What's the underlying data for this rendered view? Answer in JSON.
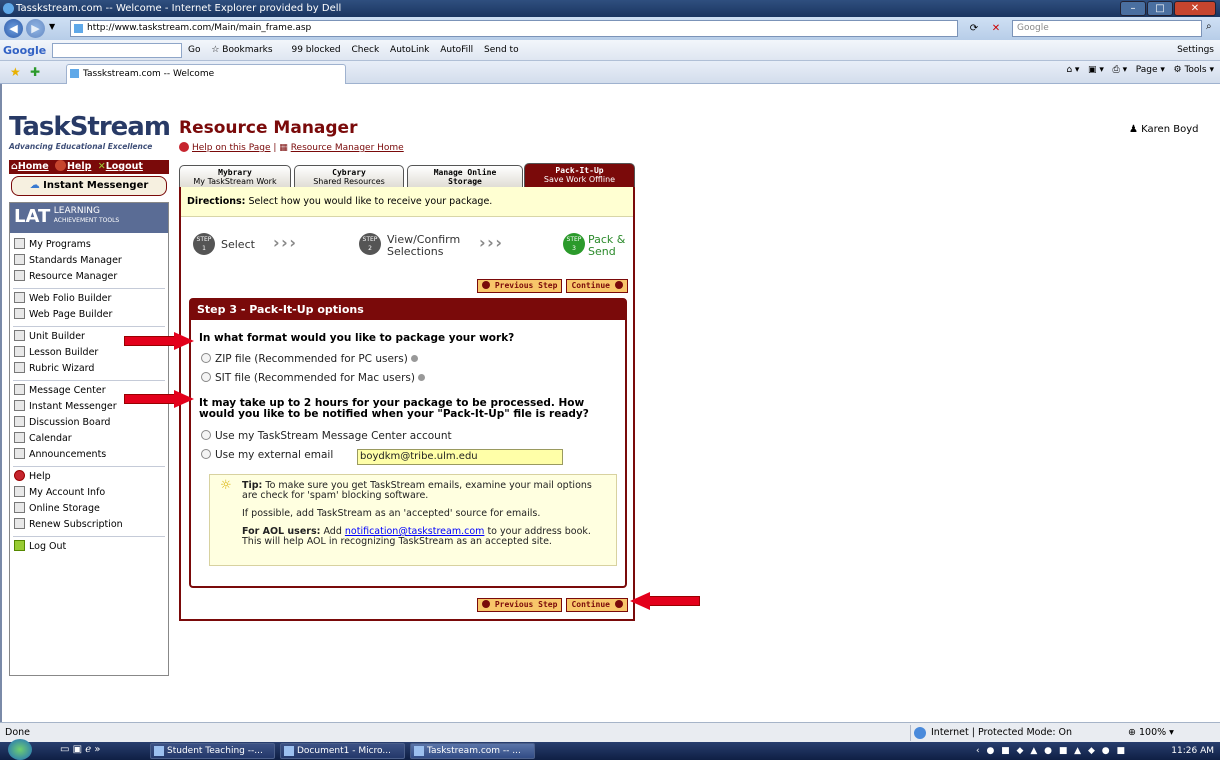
{
  "browser": {
    "window_title": "Tasskstream.com -- Welcome - Internet Explorer provided by Dell",
    "url": "http://www.taskstream.com/Main/main_frame.asp",
    "search_placeholder": "Google",
    "tab_title": "Tasskstream.com -- Welcome",
    "google_label": "Google",
    "toolbar": {
      "go": "Go",
      "bookmarks": "Bookmarks",
      "blocked": "99 blocked",
      "check": "Check",
      "autolink": "AutoLink",
      "autofill": "AutoFill",
      "sendto": "Send to",
      "settings": "Settings"
    },
    "command_bar": {
      "page": "Page",
      "tools": "Tools"
    },
    "status": "Done",
    "zone": "Internet | Protected Mode: On",
    "zoom": "100%"
  },
  "taskbar": {
    "items": [
      "Student Teaching --...",
      "Document1 - Micro...",
      "Taskstream.com -- ..."
    ],
    "clock": "11:26 AM"
  },
  "sidebar": {
    "logo_title": "TaskStream",
    "logo_tagline": "Advancing Educational Excellence",
    "home": "Home",
    "help": "Help",
    "logout": "Logout",
    "instant_messenger": "Instant Messenger",
    "lat_abbr": "LAT",
    "lat_line1": "LEARNING",
    "lat_line2": "ACHIEVEMENT TOOLS",
    "items": [
      "My Programs",
      "Standards Manager",
      "Resource Manager",
      "Web Folio Builder",
      "Web Page Builder",
      "Unit Builder",
      "Lesson Builder",
      "Rubric Wizard",
      "Message Center",
      "Instant Messenger",
      "Discussion Board",
      "Calendar",
      "Announcements",
      "Help",
      "My Account Info",
      "Online Storage",
      "Renew Subscription",
      "Log Out"
    ]
  },
  "main": {
    "title": "Resource Manager",
    "help_link": "Help on this Page",
    "home_link": "Resource Manager Home",
    "user": "Karen Boyd",
    "tabs": [
      {
        "title": "Mybrary",
        "sub": "My TaskStream Work"
      },
      {
        "title": "Cybrary",
        "sub": "Shared Resources"
      },
      {
        "title": "Manage Online",
        "sub": "Storage"
      },
      {
        "title": "Pack-It-Up",
        "sub": "Save Work Offline"
      }
    ],
    "directions_label": "Directions:",
    "directions_text": "Select how you would like to receive your package.",
    "steps": [
      {
        "badge": "STEP 1",
        "label": "Select"
      },
      {
        "badge": "STEP 2",
        "label1": "View/Confirm",
        "label2": "Selections"
      },
      {
        "badge": "STEP 3",
        "label1": "Pack &",
        "label2": "Send"
      }
    ],
    "prev_step": "Previous Step",
    "continue": "Continue",
    "options_title": "Step 3 - Pack-It-Up options",
    "q1": "In what format would you like to package your work?",
    "zip_option": "ZIP file (Recommended for PC users)",
    "sit_option": "SIT file (Recommended for Mac users)",
    "q2": "It may take up to 2 hours for your package to be processed. How would you like to be notified when your \"Pack-It-Up\" file is ready?",
    "msg_center_option": "Use my TaskStream Message Center account",
    "external_email_option": "Use my external email",
    "email_value": "boydkm@tribe.ulm.edu",
    "tip_label": "Tip:",
    "tip_text": "To make sure you get TaskStream emails, examine your mail options are check for 'spam' blocking software.",
    "tip_text2": "If possible, add TaskStream as an 'accepted' source for emails.",
    "aol_label": "For AOL users:",
    "aol_pre": "Add",
    "aol_email": "notification@taskstream.com",
    "aol_post": "to your address book. This will help AOL in recognizing TaskStream as an accepted site."
  },
  "colors": {
    "brand_maroon": "#7a0a0a",
    "directions_bg": "#ffffd2",
    "email_bg": "#ffffa8",
    "arrow_red": "#e3001b"
  }
}
